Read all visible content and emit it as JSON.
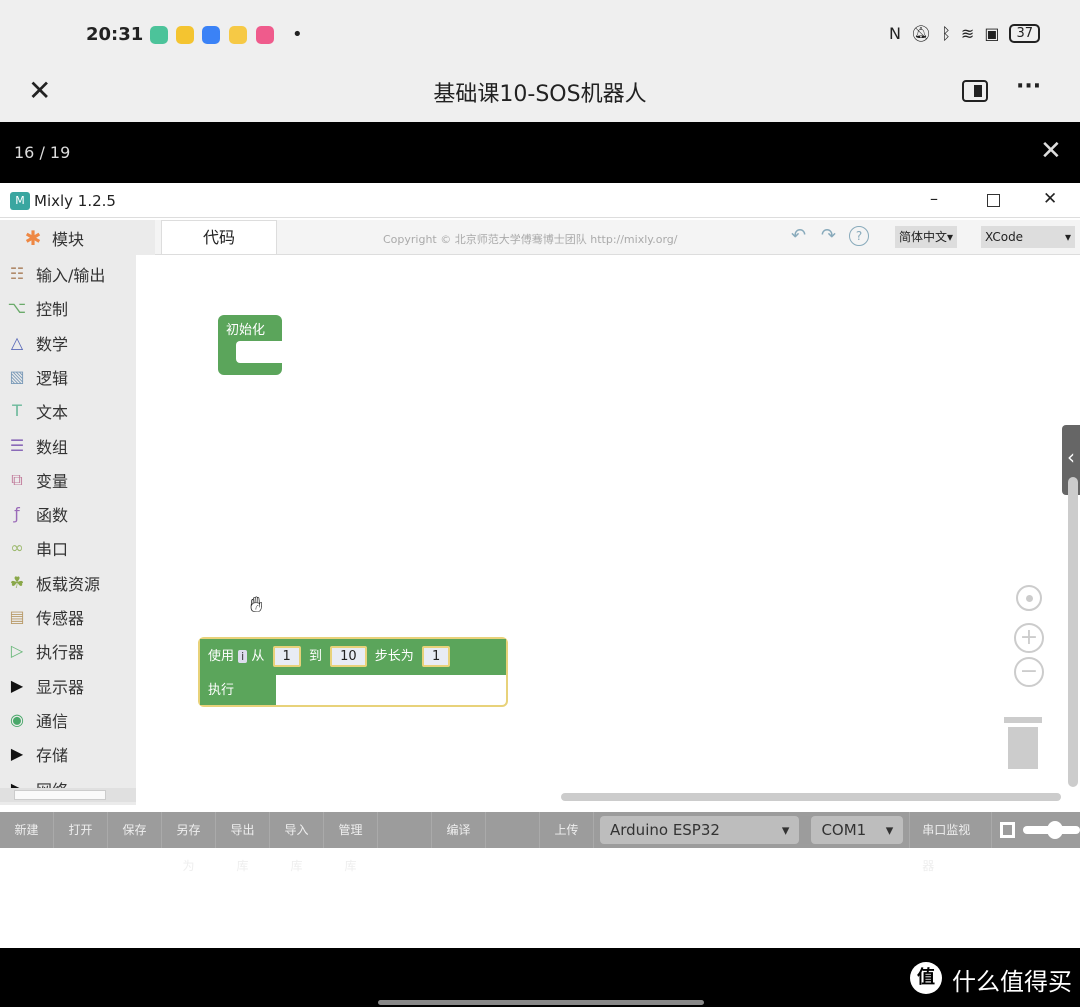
{
  "status_bar": {
    "time": "20:31",
    "battery": "37",
    "app_icon_colors": [
      "#4cc39a",
      "#f4c430",
      "#3b82f6",
      "#f6c945",
      "#ef5b8c"
    ]
  },
  "nav": {
    "title": "基础课10-SOS机器人"
  },
  "viewer": {
    "page": "16 / 19"
  },
  "window": {
    "title": "Mixly 1.2.5",
    "logo_text": "M"
  },
  "sidebar": {
    "header": "模块",
    "items": [
      {
        "label": "输入/输出",
        "icon": "☷",
        "color": "#b08a6a"
      },
      {
        "label": "控制",
        "icon": "⌥",
        "color": "#6aaa6a"
      },
      {
        "label": "数学",
        "icon": "△",
        "color": "#5a6ab8"
      },
      {
        "label": "逻辑",
        "icon": "▧",
        "color": "#7a9ab8"
      },
      {
        "label": "文本",
        "icon": "T",
        "color": "#6ab89a"
      },
      {
        "label": "数组",
        "icon": "☰",
        "color": "#8a6ab8"
      },
      {
        "label": "变量",
        "icon": "⧉",
        "color": "#c07a9a"
      },
      {
        "label": "函数",
        "icon": "ƒ",
        "color": "#9a6ab8"
      },
      {
        "label": "串口",
        "icon": "∞",
        "color": "#9ab86a"
      },
      {
        "label": "板载资源",
        "icon": "☘",
        "color": "#8aa84a"
      },
      {
        "label": "传感器",
        "icon": "▤",
        "color": "#b89a6a"
      },
      {
        "label": "执行器",
        "icon": "▷",
        "color": "#6ab87a"
      },
      {
        "label": "显示器",
        "icon": "▶",
        "color": "#111"
      },
      {
        "label": "通信",
        "icon": "◉",
        "color": "#4aa86a"
      },
      {
        "label": "存储",
        "icon": "▶",
        "color": "#111"
      },
      {
        "label": "网络",
        "icon": "▶",
        "color": "#111"
      }
    ]
  },
  "topbar": {
    "tab": "代码",
    "copyright": "Copyright © 北京师范大学傅骞博士团队 http://mixly.org/",
    "language": "简体中文▾",
    "theme": "XCode"
  },
  "blocks": {
    "setup": "初始化",
    "for_use": "使用",
    "var": "i",
    "from": "从",
    "from_val": "1",
    "to": "到",
    "to_val": "10",
    "step": "步长为",
    "step_val": "1",
    "do": "执行"
  },
  "toolbar": {
    "buttons": [
      "新建",
      "打开",
      "保存",
      "另存为",
      "导出库",
      "导入库",
      "管理库",
      "",
      "编译",
      "",
      "上传"
    ],
    "board": "Arduino ESP32",
    "port": "COM1",
    "serial_monitor": "串口监视器"
  },
  "footer": {
    "watermark": "什么值得买",
    "badge": "值"
  }
}
